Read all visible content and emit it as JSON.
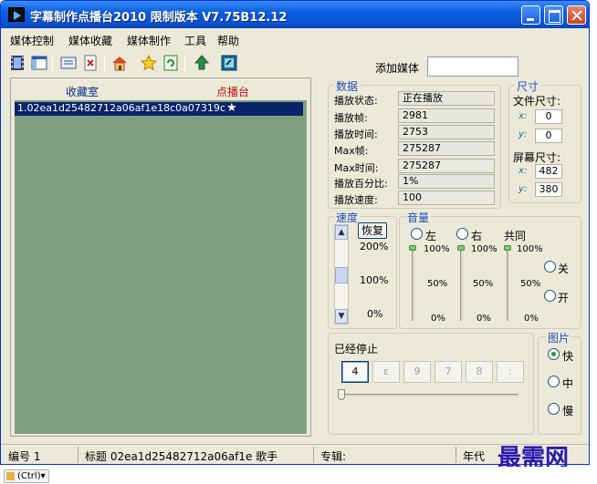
{
  "window": {
    "title": "字幕制作点播台2010 限制版本 V7.75B12.12"
  },
  "menu": [
    "媒体控制",
    "媒体收藏",
    "媒体制作",
    "工具",
    "帮助"
  ],
  "toolbar": {
    "add_media_label": "添加媒体",
    "add_media_value": ""
  },
  "list": {
    "favorites_header": "收藏室",
    "playlist_header": "点播台",
    "items": [
      {
        "name": "1.02ea1d25482712a06af1e18c0a07319c",
        "mark": "★"
      }
    ]
  },
  "data_panel": {
    "title": "数据",
    "rows": [
      {
        "label": "播放状态:",
        "value": "正在播放"
      },
      {
        "label": "播放帧:",
        "value": "2981"
      },
      {
        "label": "播放时间:",
        "value": "2753"
      },
      {
        "label": "Max帧:",
        "value": "275287"
      },
      {
        "label": "Max时间:",
        "value": "275287"
      },
      {
        "label": "播放百分比:",
        "value": "1%"
      },
      {
        "label": "播放速度:",
        "value": "100"
      }
    ]
  },
  "size_panel": {
    "title": "尺寸",
    "file_size_label": "文件尺寸:",
    "file_x": "0",
    "file_y": "0",
    "screen_size_label": "屏幕尺寸:",
    "screen_x": "482",
    "screen_y": "380",
    "x_label": "x:",
    "y_label": "y:"
  },
  "speed_panel": {
    "title": "速度",
    "restore_label": "恢复",
    "marks": [
      "200%",
      "100%",
      "0%"
    ]
  },
  "volume_panel": {
    "title": "音量",
    "left_label": "左",
    "right_label": "右",
    "both_label": "共同",
    "marks_top": "100%",
    "marks_mid": "50%",
    "marks_bottom": "0%",
    "off_label": "关",
    "on_label": "开"
  },
  "frame_panel": {
    "status": "已经停止",
    "buttons": [
      "4",
      "ε",
      "9",
      "7",
      "8",
      ":"
    ]
  },
  "image_panel": {
    "title": "图片",
    "fast": "快",
    "medium": "中",
    "slow": "慢"
  },
  "status": {
    "number_label": "编号 1",
    "title_label": "标题 02ea1d25482712a06af1e 歌手",
    "album_label": "专辑:",
    "year_label": "年代"
  },
  "watermark": "最需网",
  "taskbar_chip": "(Ctrl)▾"
}
